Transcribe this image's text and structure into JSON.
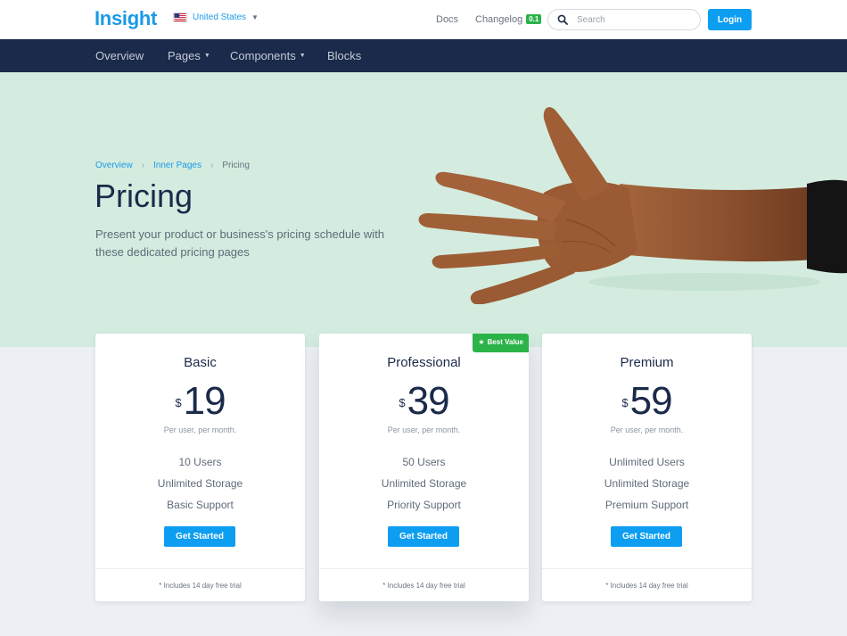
{
  "header": {
    "logo": "Insight",
    "country": "United States",
    "docs": "Docs",
    "changelog": "Changelog",
    "changelog_badge": "0.1",
    "search_placeholder": "Search",
    "login": "Login"
  },
  "nav": {
    "items": [
      {
        "label": "Overview"
      },
      {
        "label": "Pages"
      },
      {
        "label": "Components"
      },
      {
        "label": "Blocks"
      }
    ]
  },
  "hero": {
    "breadcrumb": [
      "Overview",
      "Inner Pages",
      "Pricing"
    ],
    "title": "Pricing",
    "description": "Present your product or business's pricing schedule with these dedicated pricing pages"
  },
  "plans": [
    {
      "name": "Basic",
      "currency": "$",
      "price": "19",
      "period": "Per user, per month.",
      "features": [
        "10 Users",
        "Unlimited Storage",
        "Basic Support"
      ],
      "cta": "Get Started",
      "note": "* Includes 14 day free trial"
    },
    {
      "name": "Professional",
      "currency": "$",
      "price": "39",
      "period": "Per user, per month.",
      "features": [
        "50 Users",
        "Unlimited Storage",
        "Priority Support"
      ],
      "cta": "Get Started",
      "note": "* Includes 14 day free trial",
      "badge": "Best Value"
    },
    {
      "name": "Premium",
      "currency": "$",
      "price": "59",
      "period": "Per user, per month.",
      "features": [
        "Unlimited Users",
        "Unlimited Storage",
        "Premium Support"
      ],
      "cta": "Get Started",
      "note": "* Includes 14 day free trial"
    }
  ],
  "icons": {
    "flag": "us-flag-icon",
    "search": "search-icon",
    "dropdown": "caret-down-icon",
    "breadcrumb_sep": "chevron-right-icon",
    "badge": "star-icon"
  },
  "colors": {
    "brand": "#1a9ae8",
    "primary_button": "#0d9ef2",
    "navbar": "#1b2a4a",
    "hero_bg": "#d3ecdf",
    "badge_green": "#2bb34a",
    "page_bg": "#eceff3"
  }
}
